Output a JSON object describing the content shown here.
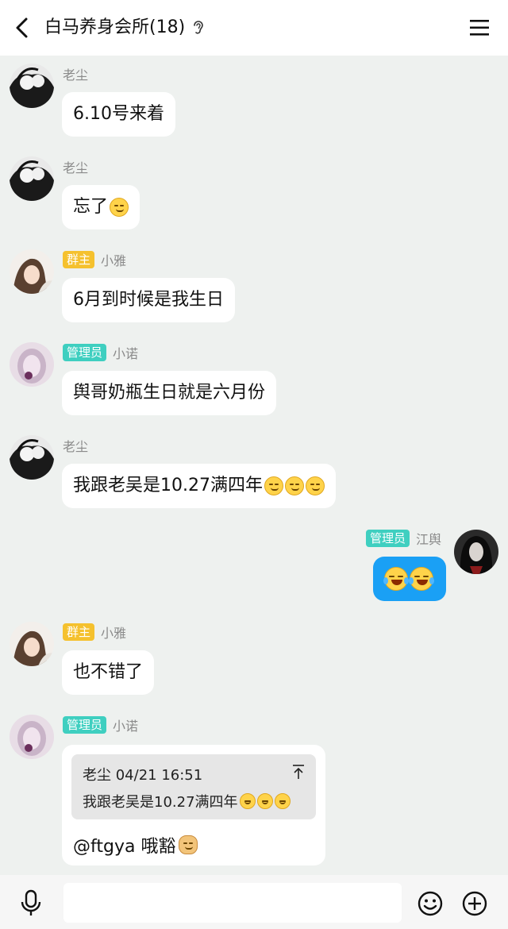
{
  "header": {
    "title": "白马养身会所(18)",
    "back_icon": "chevron-left-icon",
    "ear_icon": "ear-icon",
    "menu_icon": "hamburger-menu-icon"
  },
  "messages": [
    {
      "sender": "老尘",
      "badge": "",
      "text": "6.10号来着"
    },
    {
      "sender": "老尘",
      "badge": "",
      "text": "忘了",
      "emoji": "face-emoji"
    },
    {
      "sender": "小雅",
      "badge": "群主",
      "text": "6月到时候是我生日"
    },
    {
      "sender": "小诺",
      "badge": "管理员",
      "text": "舆哥奶瓶生日就是六月份"
    },
    {
      "sender": "老尘",
      "badge": "",
      "text": "我跟老吴是10.27满四年",
      "emoji": "face-emojis"
    },
    {
      "sender": "江舆",
      "badge": "管理员",
      "text": "",
      "emoji": "tears-of-joy-emoji"
    },
    {
      "sender": "小雅",
      "badge": "群主",
      "text": "也不错了"
    },
    {
      "sender": "小诺",
      "badge": "管理员",
      "quote": {
        "header": "老尘 04/21 16:51",
        "text": "我跟老吴是10.27满四年"
      },
      "text": "@ftgya 哦豁"
    }
  ],
  "composer": {
    "placeholder": "",
    "mic_icon": "microphone-icon",
    "emoji_icon": "smiley-icon",
    "plus_icon": "plus-circle-icon"
  },
  "colors": {
    "background": "#eef1ef",
    "owner_badge": "#f5c12e",
    "admin_badge": "#3fcfc0",
    "self_bubble": "#1aa0f5"
  }
}
